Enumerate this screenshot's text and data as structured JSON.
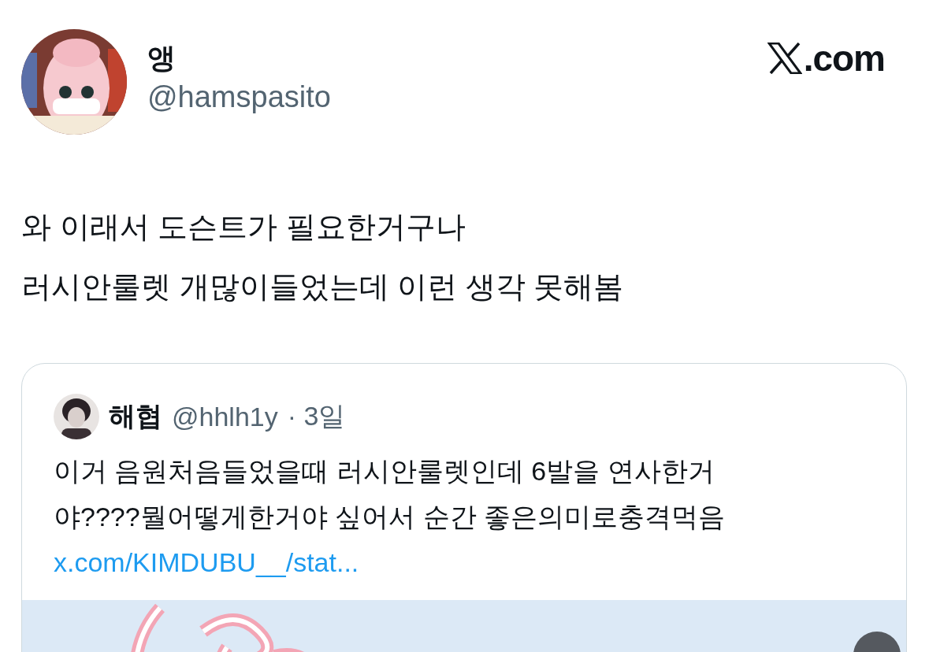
{
  "author": {
    "name": "앵",
    "handle": "@hamspasito"
  },
  "brand": {
    "suffix": ".com"
  },
  "post": {
    "lines": [
      "와 이래서 도슨트가 필요한거구나",
      "러시안룰렛 개많이들었는데 이런 생각 못해봄"
    ]
  },
  "quote": {
    "name": "해협",
    "handle": "@hhlh1y",
    "time": "· 3일",
    "lines": [
      "이거 음원처음들었을때 러시안룰렛인데 6발을 연사한거",
      "야????뭘어떻게한거야 싶어서 순간 좋은의미로충격먹음"
    ],
    "link": "x.com/KIMDUBU__/stat..."
  }
}
